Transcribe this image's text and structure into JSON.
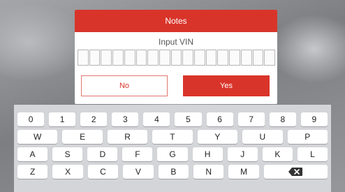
{
  "dialog": {
    "title": "Notes",
    "prompt": "Input VIN",
    "vin_slots": 17,
    "no_label": "No",
    "yes_label": "Yes"
  },
  "keyboard": {
    "rows": [
      [
        "0",
        "1",
        "2",
        "3",
        "4",
        "5",
        "6",
        "7",
        "8",
        "9"
      ],
      [
        "W",
        "E",
        "R",
        "T",
        "Y",
        "U",
        "P"
      ],
      [
        "A",
        "S",
        "D",
        "F",
        "G",
        "H",
        "J",
        "K",
        "L"
      ],
      [
        "Z",
        "X",
        "C",
        "V",
        "B",
        "N",
        "M"
      ]
    ],
    "backspace_icon": "backspace-icon"
  },
  "colors": {
    "accent": "#d9342a",
    "keyboard_bg": "#d4d5d8"
  }
}
